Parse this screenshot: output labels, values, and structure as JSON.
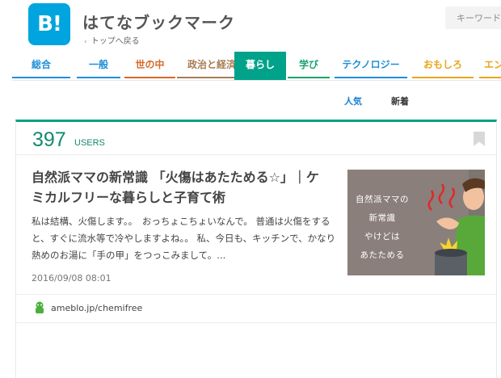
{
  "header": {
    "logo_text": "B!",
    "site_title": "はてなブックマーク",
    "back_link": "トップへ戻る",
    "search_placeholder": "キーワード"
  },
  "categories": [
    {
      "label": "総合",
      "color": "#1d8fd8"
    },
    {
      "label": "一般",
      "color": "#1d8fd8"
    },
    {
      "label": "世の中",
      "color": "#d66a2a"
    },
    {
      "label": "政治と経済",
      "color": "#a87c54"
    },
    {
      "label": "暮らし",
      "color": "#00a28a",
      "active": true
    },
    {
      "label": "学び",
      "color": "#1aa26e"
    },
    {
      "label": "テクノロジー",
      "color": "#1d8fd8"
    },
    {
      "label": "おもしろ",
      "color": "#e8a619"
    },
    {
      "label": "エンタメ",
      "color": "#e8a619"
    }
  ],
  "sub_tabs": {
    "popular": "人気",
    "new": "新着"
  },
  "entry": {
    "users_count": "397",
    "users_label": "USERS",
    "title": "自然派ママの新常識 「火傷はあたためる☆」｜ケミカルフリーな暮らしと子育て術",
    "description": "私は結構、火傷します。。　おっちょこちょいなんで。 普通は火傷をすると、すぐに流水等で冷やしますよね。。 私、今日も、キッチンで、かなり熱めのお湯に「手の甲」をつっこみまして。...",
    "date": "2016/09/08 08:01",
    "thumbnail_lines": [
      "自然派ママの",
      "新常識",
      "やけどは",
      "あたためる"
    ],
    "domain": "ameblo.jp/chemifree"
  }
}
